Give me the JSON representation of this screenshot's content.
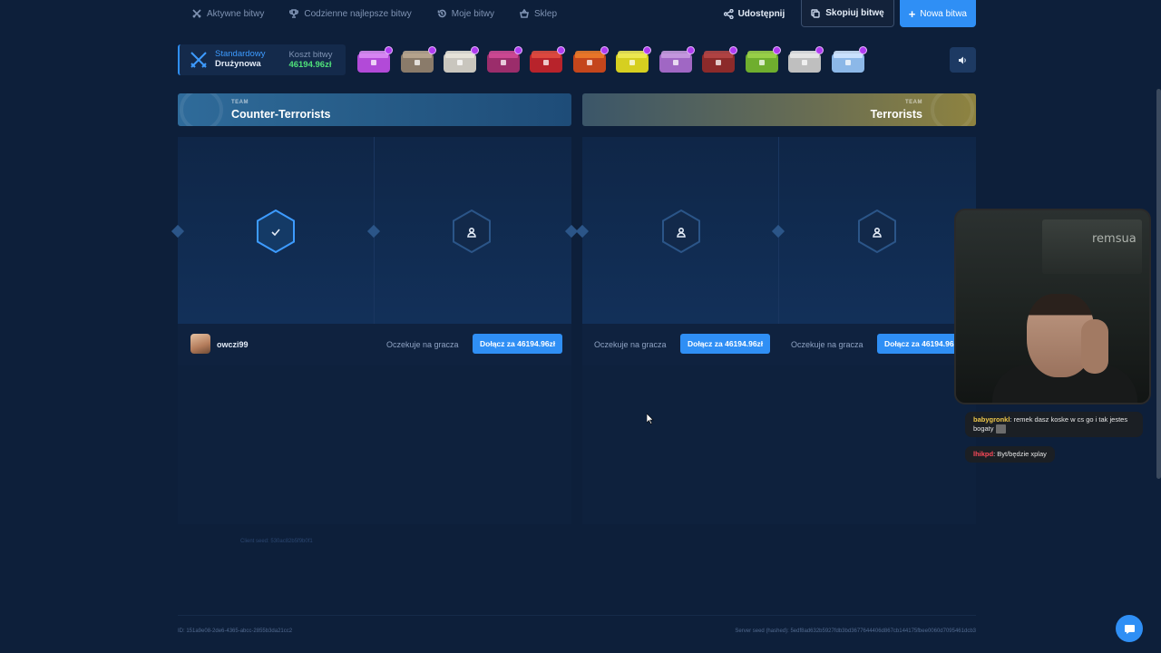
{
  "nav": {
    "links": [
      {
        "label": "Aktywne bitwy",
        "icon": "swords-icon"
      },
      {
        "label": "Codzienne najlepsze bitwy",
        "icon": "trophy-icon"
      },
      {
        "label": "Moje bitwy",
        "icon": "history-icon"
      },
      {
        "label": "Sklep",
        "icon": "basket-icon"
      }
    ],
    "share_label": "Udostępnij",
    "copy_label": "Skopiuj bitwę",
    "new_label": "Nowa bitwa"
  },
  "battle": {
    "mode_type": "Standardowy",
    "mode_name": "Drużynowa",
    "cost_label": "Koszt bitwy",
    "cost_value": "46194.96zł",
    "cases": [
      {
        "color": "#b24ad8",
        "lid": "#d98cf5"
      },
      {
        "color": "#8a7b6a",
        "lid": "#b8a690"
      },
      {
        "color": "#c9c6be",
        "lid": "#e8e4da"
      },
      {
        "color": "#9b2d6b",
        "lid": "#d04a96"
      },
      {
        "color": "#b8232b",
        "lid": "#e04b40"
      },
      {
        "color": "#c4461c",
        "lid": "#ec7a2a"
      },
      {
        "color": "#d6cf20",
        "lid": "#f0ea55"
      },
      {
        "color": "#a067c4",
        "lid": "#c69be0"
      },
      {
        "color": "#8c2a2a",
        "lid": "#b34545"
      },
      {
        "color": "#6fae2e",
        "lid": "#9bd24a"
      },
      {
        "color": "#bfbfbf",
        "lid": "#e8e8e8"
      },
      {
        "color": "#8cb8e8",
        "lid": "#cfe6ff"
      }
    ]
  },
  "teams": {
    "ct": {
      "label": "TEAM",
      "name": "Counter-Terrorists"
    },
    "t": {
      "label": "TEAM",
      "name": "Terrorists"
    }
  },
  "slots": {
    "player1": "owczi99",
    "waiting": "Oczekuje na gracza",
    "join": "Dołącz za 46194.96zł"
  },
  "seeds": {
    "client": "Client seed: 530ac82b5f9b0f1",
    "battle_id": "ID: 151a9e08-2de6-4365-abcc-2855b3da21cc2",
    "server": "Server seed (hashed): 5edf8ad632b5927fdb3bd3677644406d867cb144175fbee0060d7095461dcb3"
  },
  "chat": [
    {
      "user": "babygronkl",
      "text": "remek dasz koske w cs go i tak jestes bogaty"
    },
    {
      "user": "lhikpd",
      "text": "Byt/będzie xplay"
    }
  ],
  "webcam": {
    "sign": "remsua"
  }
}
